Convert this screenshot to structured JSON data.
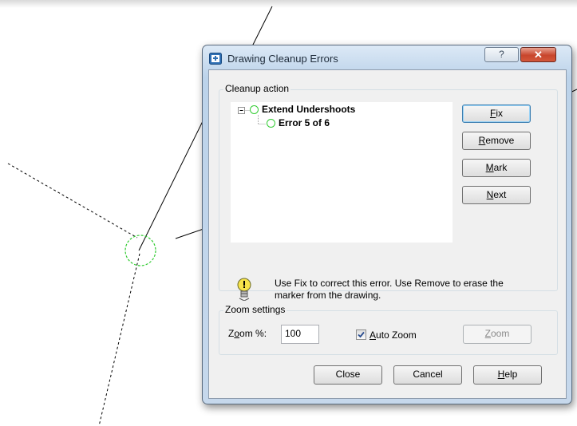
{
  "dialog": {
    "title": "Drawing Cleanup Errors",
    "help_glyph": "?",
    "close_glyph": "✕"
  },
  "cleanup": {
    "group_label": "Cleanup action",
    "tree": {
      "parent_label": "Extend Undershoots",
      "child_label": "Error 5 of 6"
    },
    "buttons": {
      "fix": {
        "pre": "",
        "key": "F",
        "post": "ix"
      },
      "remove": {
        "pre": "",
        "key": "R",
        "post": "emove"
      },
      "mark": {
        "pre": "",
        "key": "M",
        "post": "ark"
      },
      "next": {
        "pre": "",
        "key": "N",
        "post": "ext"
      }
    },
    "info_text": "Use Fix to correct this error. Use Remove to erase the  marker from the drawing.",
    "info_icon": "lightbulb-icon"
  },
  "zoom": {
    "group_label": "Zoom settings",
    "label": {
      "pre": "Z",
      "key": "o",
      "post": "om %:"
    },
    "value": "100",
    "auto_zoom": {
      "checked": true,
      "pre": "",
      "key": "A",
      "post": "uto Zoom"
    },
    "zoom_button": {
      "pre": "",
      "key": "Z",
      "post": "oom"
    }
  },
  "footer": {
    "close": "Close",
    "cancel": "Cancel",
    "help": {
      "pre": "",
      "key": "H",
      "post": "elp"
    }
  },
  "colors": {
    "marker": "#33cc33",
    "title_bar": "#c6d8ec",
    "close_red": "#c8452c"
  }
}
